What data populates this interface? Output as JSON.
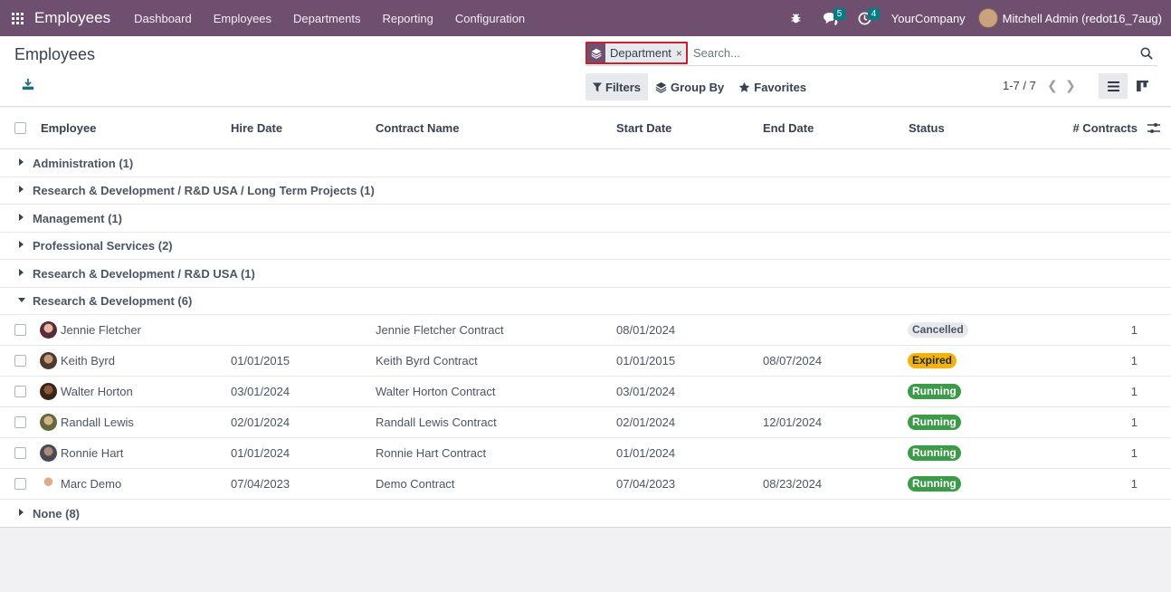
{
  "navbar": {
    "app_name": "Employees",
    "menu": [
      "Dashboard",
      "Employees",
      "Departments",
      "Reporting",
      "Configuration"
    ],
    "messages_count": "5",
    "activities_count": "4",
    "company": "YourCompany",
    "user": "Mitchell Admin (redot16_7aug)"
  },
  "control": {
    "title": "Employees",
    "facet_label": "Department",
    "facet_remove": "×",
    "search_placeholder": "Search...",
    "filters_label": "Filters",
    "groupby_label": "Group By",
    "favorites_label": "Favorites",
    "pager": "1-7 / 7"
  },
  "columns": {
    "employee": "Employee",
    "hire_date": "Hire Date",
    "contract_name": "Contract Name",
    "start_date": "Start Date",
    "end_date": "End Date",
    "status": "Status",
    "contracts": "# Contracts"
  },
  "groups_top": [
    "Administration (1)",
    "Research & Development / R&D USA / Long Term Projects (1)",
    "Management (1)",
    "Professional Services (2)",
    "Research & Development / R&D USA (1)"
  ],
  "open_group": "Research & Development (6)",
  "rows": [
    {
      "employee": "Jennie Fletcher",
      "hire_date": "",
      "contract": "Jennie Fletcher Contract",
      "start": "08/01/2024",
      "end": "",
      "status": "Cancelled",
      "count": "1"
    },
    {
      "employee": "Keith Byrd",
      "hire_date": "01/01/2015",
      "contract": "Keith Byrd Contract",
      "start": "01/01/2015",
      "end": "08/07/2024",
      "status": "Expired",
      "count": "1"
    },
    {
      "employee": "Walter Horton",
      "hire_date": "03/01/2024",
      "contract": "Walter Horton Contract",
      "start": "03/01/2024",
      "end": "",
      "status": "Running",
      "count": "1"
    },
    {
      "employee": "Randall Lewis",
      "hire_date": "02/01/2024",
      "contract": "Randall Lewis Contract",
      "start": "02/01/2024",
      "end": "12/01/2024",
      "status": "Running",
      "count": "1"
    },
    {
      "employee": "Ronnie Hart",
      "hire_date": "01/01/2024",
      "contract": "Ronnie Hart Contract",
      "start": "01/01/2024",
      "end": "",
      "status": "Running",
      "count": "1"
    },
    {
      "employee": "Marc Demo",
      "hire_date": "07/04/2023",
      "contract": "Demo Contract",
      "start": "07/04/2023",
      "end": "08/23/2024",
      "status": "Running",
      "count": "1"
    }
  ],
  "bottom_group": "None (8)",
  "colors": {
    "navbar": "#6f4f6f",
    "running": "#3c9b48",
    "expired": "#f3b30a",
    "cancelled": "#e7e9ed",
    "facet_highlight": "#c8202d"
  }
}
